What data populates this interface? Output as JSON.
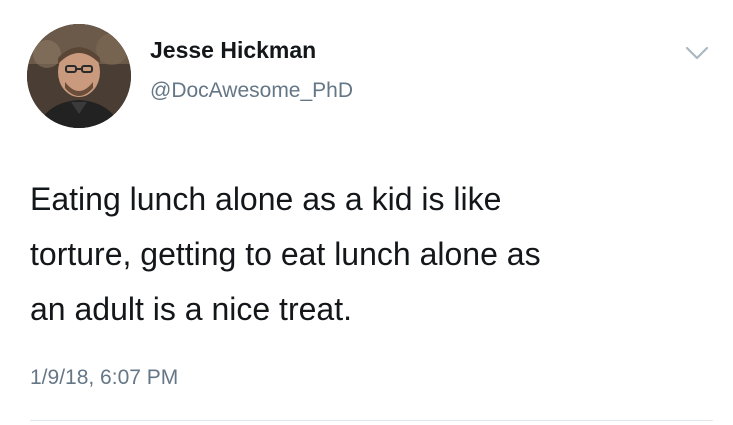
{
  "tweet": {
    "author": {
      "name": "Jesse Hickman",
      "handle": "@DocAwesome_PhD"
    },
    "text": "Eating lunch alone as a kid is like\ntorture, getting to eat lunch alone as\nan adult is a nice treat.",
    "timestamp": "1/9/18, 6:07 PM",
    "icons": {
      "menu": "chevron-down-icon",
      "avatar": "avatar"
    }
  }
}
